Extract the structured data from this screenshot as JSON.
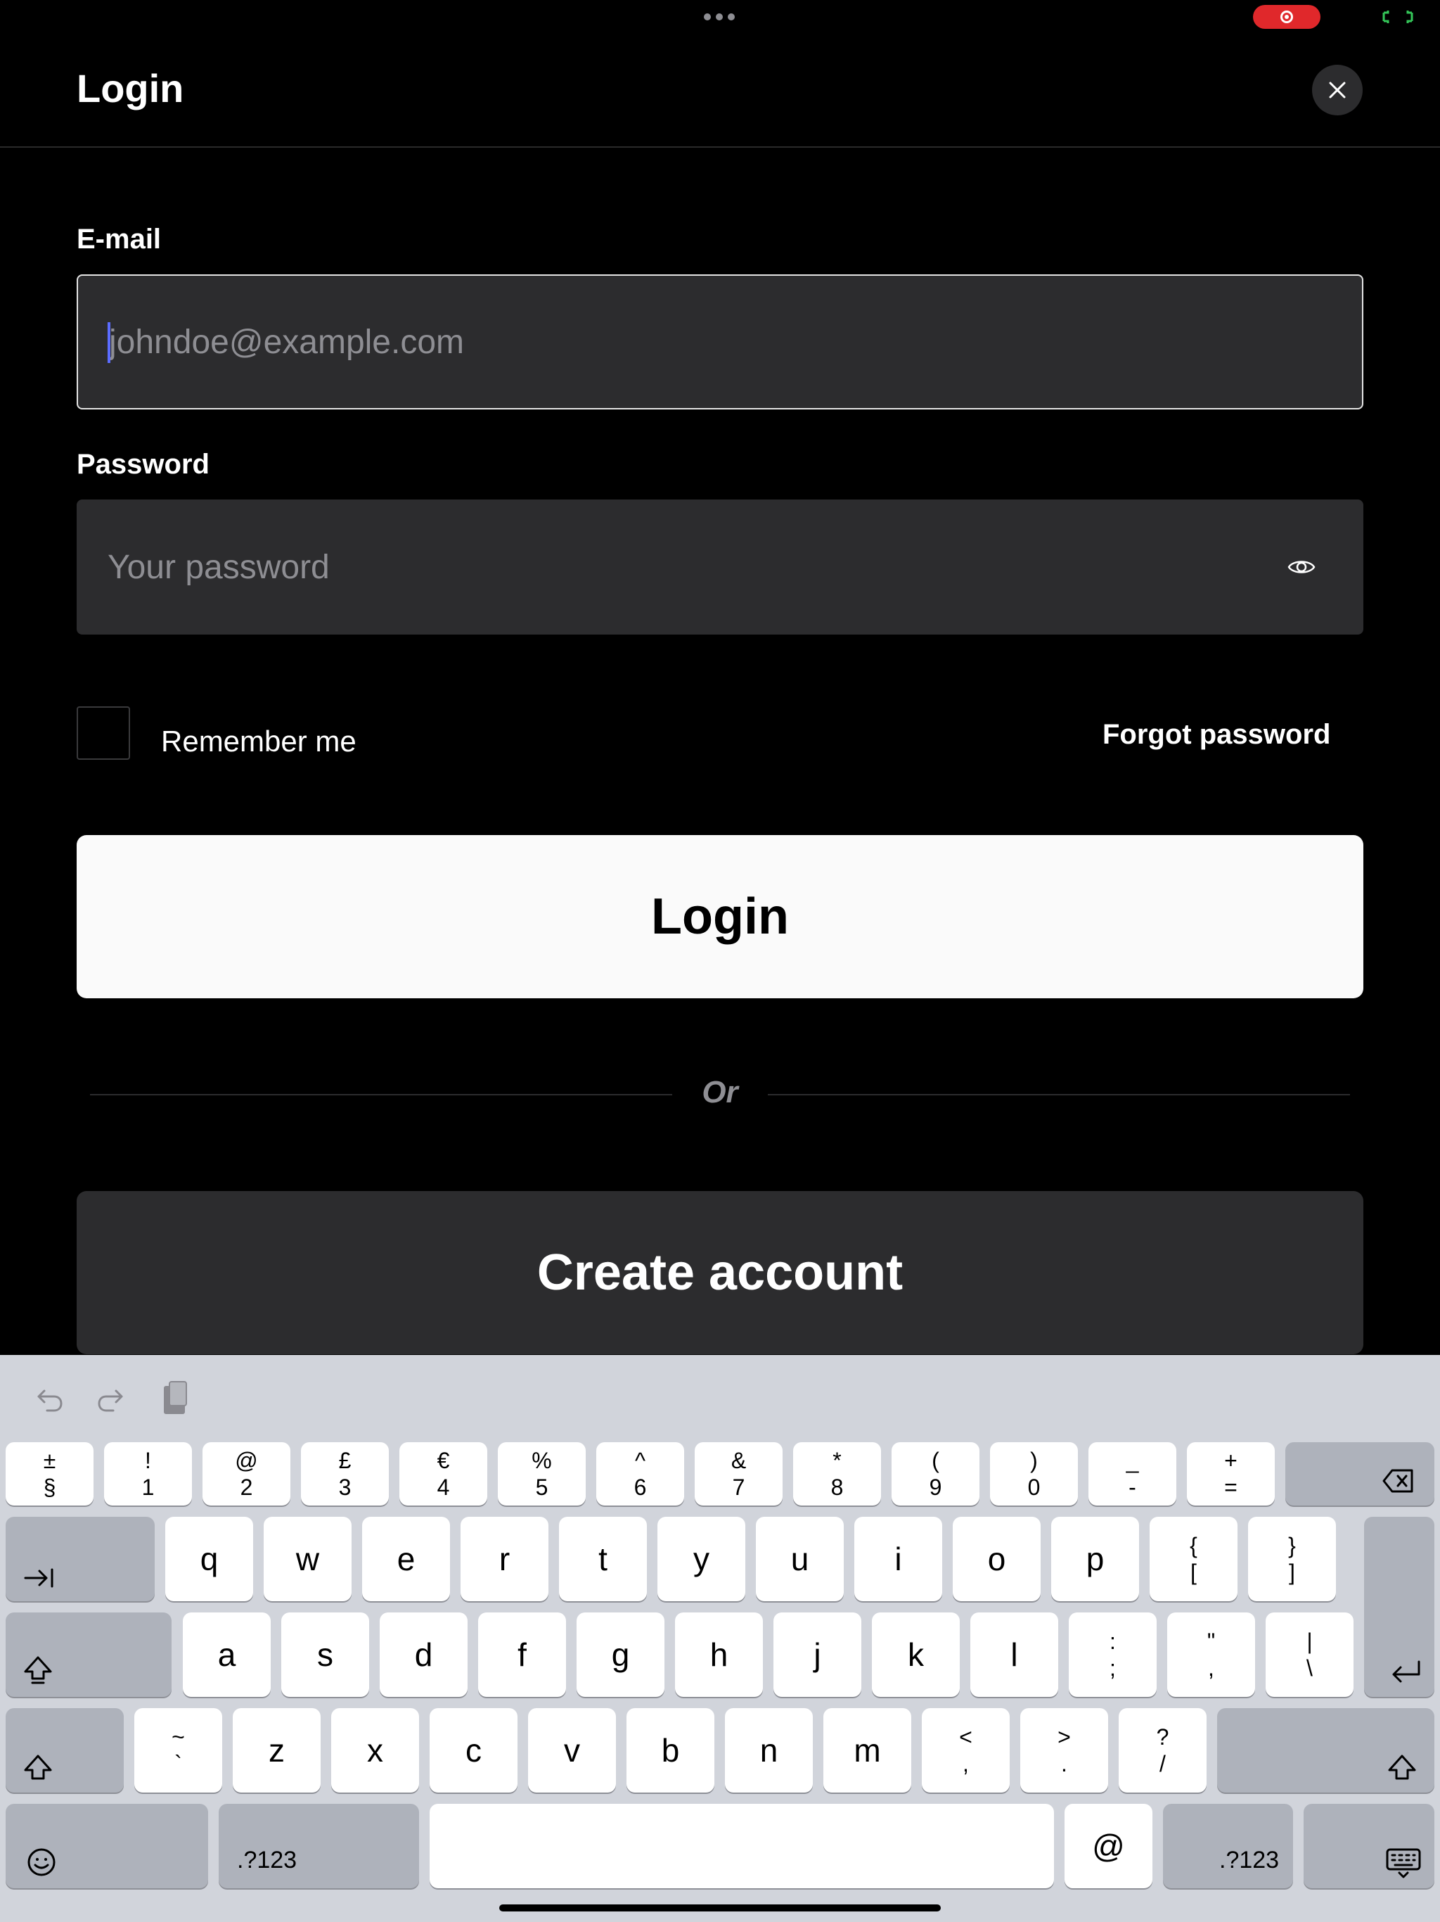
{
  "header": {
    "title": "Login",
    "close_label": "Close"
  },
  "form": {
    "email_label": "E-mail",
    "email_placeholder": "johndoe@example.com",
    "password_label": "Password",
    "password_placeholder": "Your password",
    "remember_label": "Remember me",
    "forgot_label": "Forgot password",
    "login_label": "Login",
    "or_label": "Or",
    "create_label": "Create account"
  },
  "keyboard": {
    "number_row": [
      {
        "top": "±",
        "bottom": "§"
      },
      {
        "top": "!",
        "bottom": "1"
      },
      {
        "top": "@",
        "bottom": "2"
      },
      {
        "top": "£",
        "bottom": "3"
      },
      {
        "top": "€",
        "bottom": "4"
      },
      {
        "top": "%",
        "bottom": "5"
      },
      {
        "top": "^",
        "bottom": "6"
      },
      {
        "top": "&",
        "bottom": "7"
      },
      {
        "top": "*",
        "bottom": "8"
      },
      {
        "top": "(",
        "bottom": "9"
      },
      {
        "top": ")",
        "bottom": "0"
      },
      {
        "top": "_",
        "bottom": "-"
      },
      {
        "top": "+",
        "bottom": "="
      }
    ],
    "row_q": [
      "q",
      "w",
      "e",
      "r",
      "t",
      "y",
      "u",
      "i",
      "o",
      "p"
    ],
    "row_q_symbols": [
      {
        "top": "{",
        "bottom": "["
      },
      {
        "top": "}",
        "bottom": "]"
      }
    ],
    "row_a": [
      "a",
      "s",
      "d",
      "f",
      "g",
      "h",
      "j",
      "k",
      "l"
    ],
    "row_a_symbols": [
      {
        "top": ":",
        "bottom": ";"
      },
      {
        "top": "\"",
        "bottom": ","
      },
      {
        "top": "|",
        "bottom": "\\"
      }
    ],
    "row_z_symbol_left": {
      "top": "~",
      "bottom": "`"
    },
    "row_z": [
      "z",
      "x",
      "c",
      "v",
      "b",
      "n",
      "m"
    ],
    "row_z_symbols": [
      {
        "top": "<",
        "bottom": ","
      },
      {
        "top": ">",
        "bottom": "."
      },
      {
        "top": "?",
        "bottom": "/"
      }
    ],
    "numbers_label": ".?123",
    "at_label": "@"
  },
  "colors": {
    "background": "#000000",
    "field_bg": "#2c2c2e",
    "caret": "#5b6cff",
    "record": "#e0282b",
    "keyboard_bg": "#d1d4db"
  }
}
